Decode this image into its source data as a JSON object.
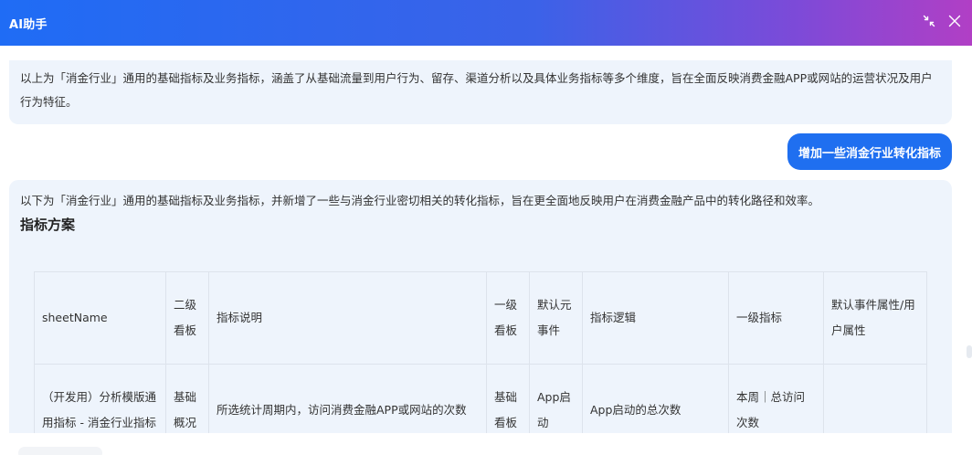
{
  "header": {
    "title": "AI助手",
    "minimize_icon": "collapse-arrows-icon",
    "close_icon": "close-icon"
  },
  "messages": {
    "ai_1": "以上为「消金行业」通用的基础指标及业务指标，涵盖了从基础流量到用户行为、留存、渠道分析以及具体业务指标等多个维度，旨在全面反映消费金融APP或网站的运营状况及用户行为特征。",
    "user_1": "增加一些消金行业转化指标",
    "ai_2_intro": "以下为「消金行业」通用的基础指标及业务指标，并新增了一些与消金行业密切相关的转化指标，旨在更全面地反映用户在消费金融产品中的转化路径和效率。",
    "ai_2_heading": "指标方案"
  },
  "table": {
    "headers": [
      "sheetName",
      "二级看板",
      "指标说明",
      "一级看板",
      "默认元事件",
      "指标逻辑",
      "一级指标",
      "默认事件属性/用户属性"
    ],
    "rows": [
      [
        "（开发用）分析模版通用指标 - 消金行业指标",
        "基础概况",
        "所选统计周期内，访问消费金融APP或网站的次数",
        "基础看板",
        "App启动",
        "App启动的总次数",
        "本周｜总访问次数",
        ""
      ]
    ]
  },
  "colors": {
    "header_gradient_start": "#1f6cf5",
    "header_gradient_end": "#b13fc5",
    "user_bubble": "#1f6ff0",
    "ai_bubble": "#eef4fc"
  }
}
